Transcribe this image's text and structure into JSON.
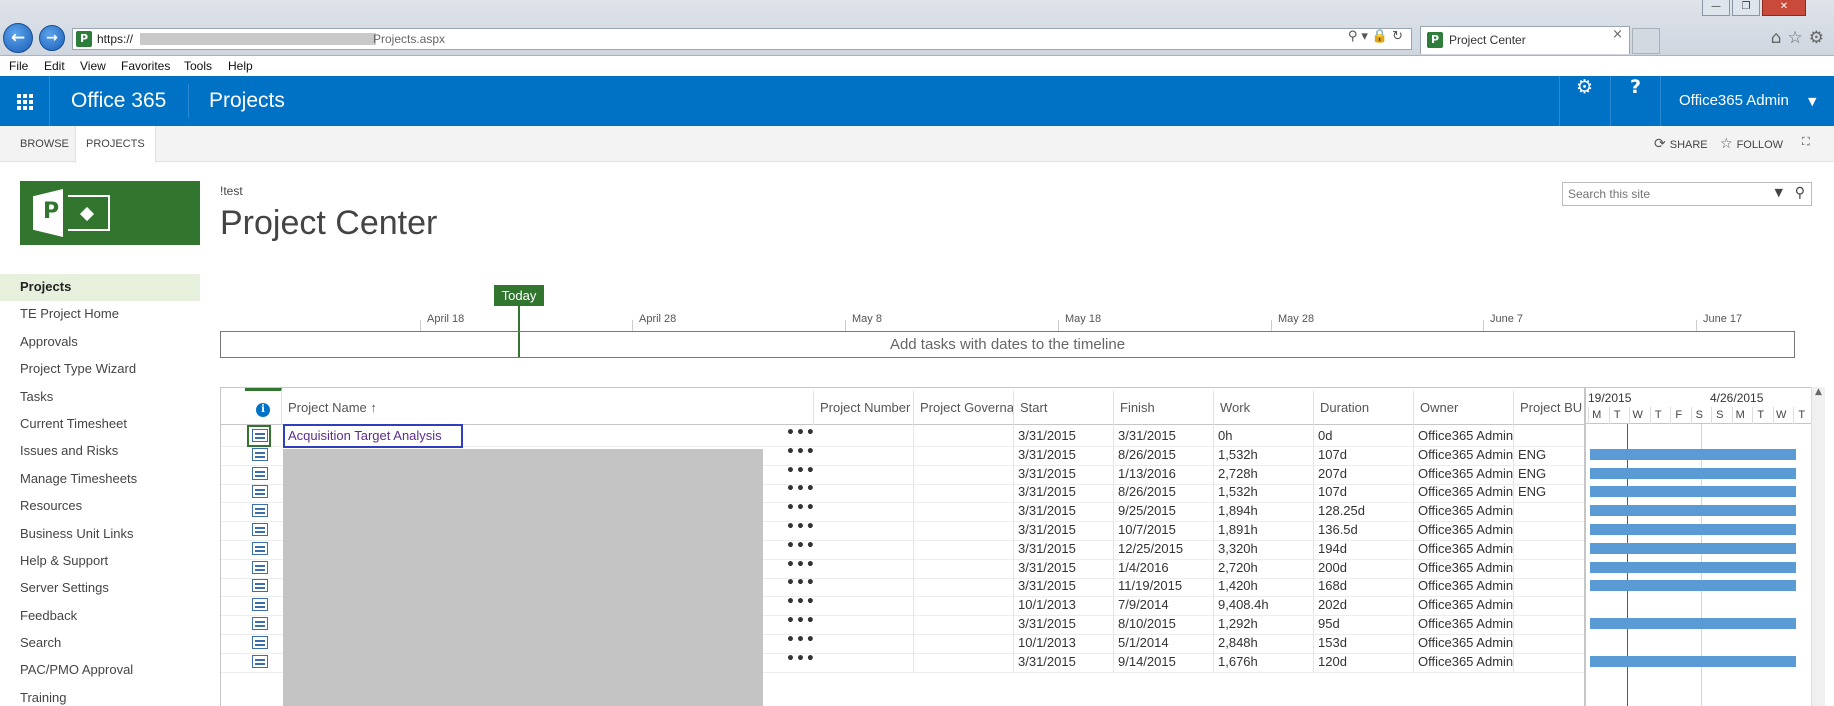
{
  "browser": {
    "url_prefix": "https://",
    "url_suffix": "Projects.aspx",
    "tab_title": "Project Center",
    "tab_close": "×",
    "favicon_letter": "P",
    "address_icons": "⚲▾🔒↻",
    "chrome_icons": "⌂☆⚙",
    "window_controls": [
      "—",
      "❐",
      "✕"
    ]
  },
  "menubar": [
    "File",
    "Edit",
    "View",
    "Favorites",
    "Tools",
    "Help"
  ],
  "suitebar": {
    "brand": "Office 365",
    "app": "Projects",
    "settings_icon": "⚙",
    "help_icon": "?",
    "user": "Office365 Admin",
    "user_caret": "▼",
    "accent": "#0072c6"
  },
  "ribbon": {
    "tabs": [
      "BROWSE",
      "PROJECTS"
    ],
    "actions": {
      "share": "SHARE",
      "follow": "FOLLOW",
      "share_icon": "⟳",
      "follow_icon": "☆",
      "focus_icon": "⛶"
    }
  },
  "logo": {
    "letter": "P",
    "color": "#31752f"
  },
  "leftnav": [
    "Projects",
    "TE Project Home",
    "Approvals",
    "Project Type Wizard",
    "Tasks",
    "Current Timesheet",
    "Issues and Risks",
    "Manage Timesheets",
    "Resources",
    "Business Unit Links",
    "Help & Support",
    "Server Settings",
    "Feedback",
    "Search",
    "PAC/PMO Approval",
    "Training"
  ],
  "header": {
    "breadcrumb": "!test",
    "title": "Project Center",
    "search_placeholder": "Search this site",
    "search_dropdown": "▼",
    "search_icon": "⚲"
  },
  "timeline": {
    "today": "Today",
    "ticks": [
      "April 18",
      "April 28",
      "May 8",
      "May 18",
      "May 28",
      "June 7",
      "June 17"
    ],
    "empty_text": "Add tasks with dates to the timeline"
  },
  "grid": {
    "info_icon": "i",
    "columns": [
      "Project Name",
      "Project Number",
      "Project Governa",
      "Start",
      "Finish",
      "Work",
      "Duration",
      "Owner",
      "Project BU"
    ],
    "sort_arrow": "↑",
    "ellipsis": "•••",
    "rows": [
      {
        "name": "Acquisition Target Analysis",
        "start": "3/31/2015",
        "finish": "3/31/2015",
        "work": "0h",
        "duration": "0d",
        "owner": "Office365 Admin",
        "bu": ""
      },
      {
        "name": "",
        "start": "3/31/2015",
        "finish": "8/26/2015",
        "work": "1,532h",
        "duration": "107d",
        "owner": "Office365 Admin",
        "bu": "ENG"
      },
      {
        "name": "",
        "start": "3/31/2015",
        "finish": "1/13/2016",
        "work": "2,728h",
        "duration": "207d",
        "owner": "Office365 Admin",
        "bu": "ENG"
      },
      {
        "name": "",
        "start": "3/31/2015",
        "finish": "8/26/2015",
        "work": "1,532h",
        "duration": "107d",
        "owner": "Office365 Admin",
        "bu": "ENG"
      },
      {
        "name": "",
        "start": "3/31/2015",
        "finish": "9/25/2015",
        "work": "1,894h",
        "duration": "128.25d",
        "owner": "Office365 Admin",
        "bu": ""
      },
      {
        "name": "",
        "start": "3/31/2015",
        "finish": "10/7/2015",
        "work": "1,891h",
        "duration": "136.5d",
        "owner": "Office365 Admin",
        "bu": ""
      },
      {
        "name": "",
        "start": "3/31/2015",
        "finish": "12/25/2015",
        "work": "3,320h",
        "duration": "194d",
        "owner": "Office365 Admin",
        "bu": ""
      },
      {
        "name": "",
        "start": "3/31/2015",
        "finish": "1/4/2016",
        "work": "2,720h",
        "duration": "200d",
        "owner": "Office365 Admin",
        "bu": ""
      },
      {
        "name": "",
        "start": "3/31/2015",
        "finish": "11/19/2015",
        "work": "1,420h",
        "duration": "168d",
        "owner": "Office365 Admin",
        "bu": ""
      },
      {
        "name": "",
        "start": "10/1/2013",
        "finish": "7/9/2014",
        "work": "9,408.4h",
        "duration": "202d",
        "owner": "Office365 Admin",
        "bu": ""
      },
      {
        "name": "",
        "start": "3/31/2015",
        "finish": "8/10/2015",
        "work": "1,292h",
        "duration": "95d",
        "owner": "Office365 Admin",
        "bu": ""
      },
      {
        "name": "",
        "start": "10/1/2013",
        "finish": "5/1/2014",
        "work": "2,848h",
        "duration": "153d",
        "owner": "Office365 Admin",
        "bu": ""
      },
      {
        "name": "",
        "start": "3/31/2015",
        "finish": "9/14/2015",
        "work": "1,676h",
        "duration": "120d",
        "owner": "Office365 Admin",
        "bu": ""
      }
    ]
  },
  "gantt": {
    "weeks": [
      "19/2015",
      "4/26/2015"
    ],
    "days": [
      "M",
      "T",
      "W",
      "T",
      "F",
      "S",
      "S",
      "M",
      "T",
      "W",
      "T"
    ],
    "bar_rows": [
      1,
      2,
      3,
      4,
      5,
      6,
      7,
      8,
      10,
      12
    ],
    "bar_color": "#5b9bd5",
    "scroll_up": "▲"
  }
}
